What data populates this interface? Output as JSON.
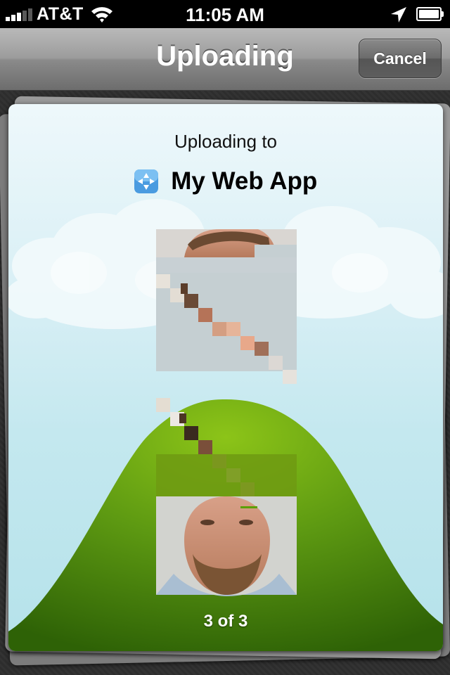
{
  "status_bar": {
    "carrier": "AT&T",
    "time": "11:05 AM",
    "signal_icon": "signal-bars-icon",
    "wifi_icon": "wifi-icon",
    "location_icon": "location-arrow-icon",
    "battery_icon": "battery-icon"
  },
  "nav": {
    "title": "Uploading",
    "cancel_label": "Cancel"
  },
  "upload": {
    "heading": "Uploading to",
    "app_icon": "app-compass-icon",
    "app_name": "My Web App",
    "progress_label": "3 of 3"
  },
  "colors": {
    "nav_gradient_top": "#b9b9b9",
    "sky": "#c4e8ef",
    "hill": "#5f9a12",
    "hill_dark": "#2f6206"
  }
}
